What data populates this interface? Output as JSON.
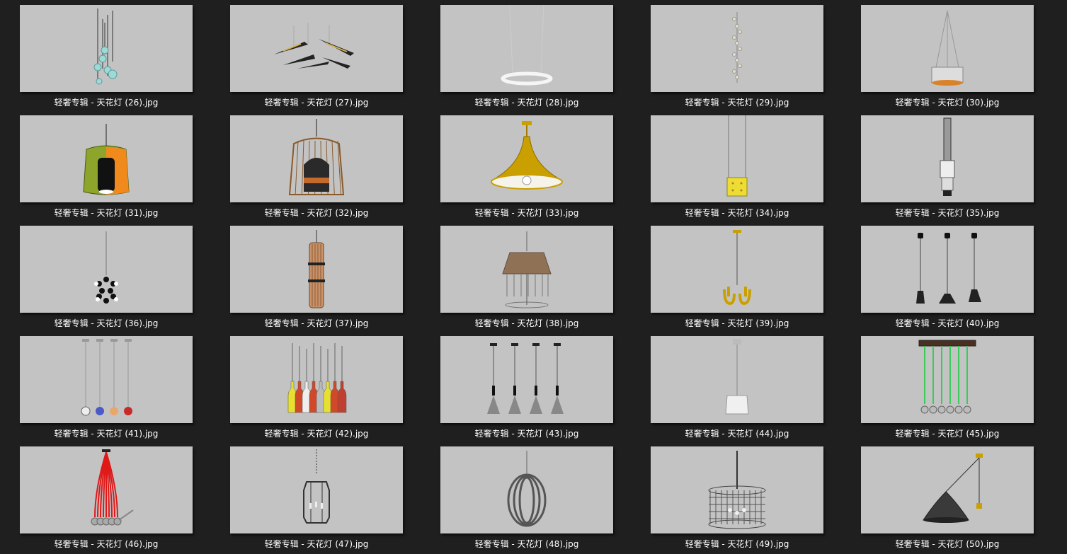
{
  "files": [
    {
      "name": "轻奢专辑 - 天花灯 (26).jpg",
      "icon": "glass-globe-cluster-lamp-icon"
    },
    {
      "name": "轻奢专辑 - 天花灯 (27).jpg",
      "icon": "leaf-blade-chandelier-icon"
    },
    {
      "name": "轻奢专辑 - 天花灯 (28).jpg",
      "icon": "ring-pendant-lamp-icon"
    },
    {
      "name": "轻奢专辑 - 天花灯 (29).jpg",
      "icon": "crystal-strand-lamp-icon"
    },
    {
      "name": "轻奢专辑 - 天花灯 (30).jpg",
      "icon": "drum-pendant-lamp-icon"
    },
    {
      "name": "轻奢专辑 - 天花灯 (31).jpg",
      "icon": "color-glass-pendant-icon"
    },
    {
      "name": "轻奢专辑 - 天花灯 (32).jpg",
      "icon": "birdcage-pendant-icon"
    },
    {
      "name": "轻奢专辑 - 天花灯 (33).jpg",
      "icon": "gold-trumpet-pendant-icon"
    },
    {
      "name": "轻奢专辑 - 天花灯 (34).jpg",
      "icon": "yellow-box-pendant-icon"
    },
    {
      "name": "轻奢专辑 - 天花灯 (35).jpg",
      "icon": "crystal-tube-pendant-icon"
    },
    {
      "name": "轻奢专辑 - 天花灯 (36).jpg",
      "icon": "bulb-sphere-cluster-icon"
    },
    {
      "name": "轻奢专辑 - 天花灯 (37).jpg",
      "icon": "wood-cylinder-pendant-icon"
    },
    {
      "name": "轻奢专辑 - 天花灯 (38).jpg",
      "icon": "shade-crystal-chandelier-icon"
    },
    {
      "name": "轻奢专辑 - 天花灯 (39).jpg",
      "icon": "gold-horn-chandelier-icon"
    },
    {
      "name": "轻奢专辑 - 天花灯 (40).jpg",
      "icon": "triple-cone-pendant-icon"
    },
    {
      "name": "轻奢专辑 - 天花灯 (41).jpg",
      "icon": "color-ball-pendant-icon"
    },
    {
      "name": "轻奢专辑 - 天花灯 (42).jpg",
      "icon": "bottle-pendant-icon"
    },
    {
      "name": "轻奢专辑 - 天花灯 (43).jpg",
      "icon": "cone-pendant-set-icon"
    },
    {
      "name": "轻奢专辑 - 天花灯 (44).jpg",
      "icon": "white-drum-pendant-icon"
    },
    {
      "name": "轻奢专辑 - 天花灯 (45).jpg",
      "icon": "green-cord-bulb-bar-icon"
    },
    {
      "name": "轻奢专辑 - 天花灯 (46).jpg",
      "icon": "red-cord-bundle-lamp-icon"
    },
    {
      "name": "轻奢专辑 - 天花灯 (47).jpg",
      "icon": "lantern-cage-pendant-icon"
    },
    {
      "name": "轻奢专辑 - 天花灯 (48).jpg",
      "icon": "orb-ring-chandelier-icon"
    },
    {
      "name": "轻奢专辑 - 天花灯 (49).jpg",
      "icon": "wire-drum-chandelier-icon"
    },
    {
      "name": "轻奢专辑 - 天花灯 (50).jpg",
      "icon": "pulley-dome-pendant-icon"
    }
  ],
  "colors": {
    "background": "#1f1f1f",
    "thumb_background": "#c3c3c3",
    "caption_text": "#ffffff"
  }
}
